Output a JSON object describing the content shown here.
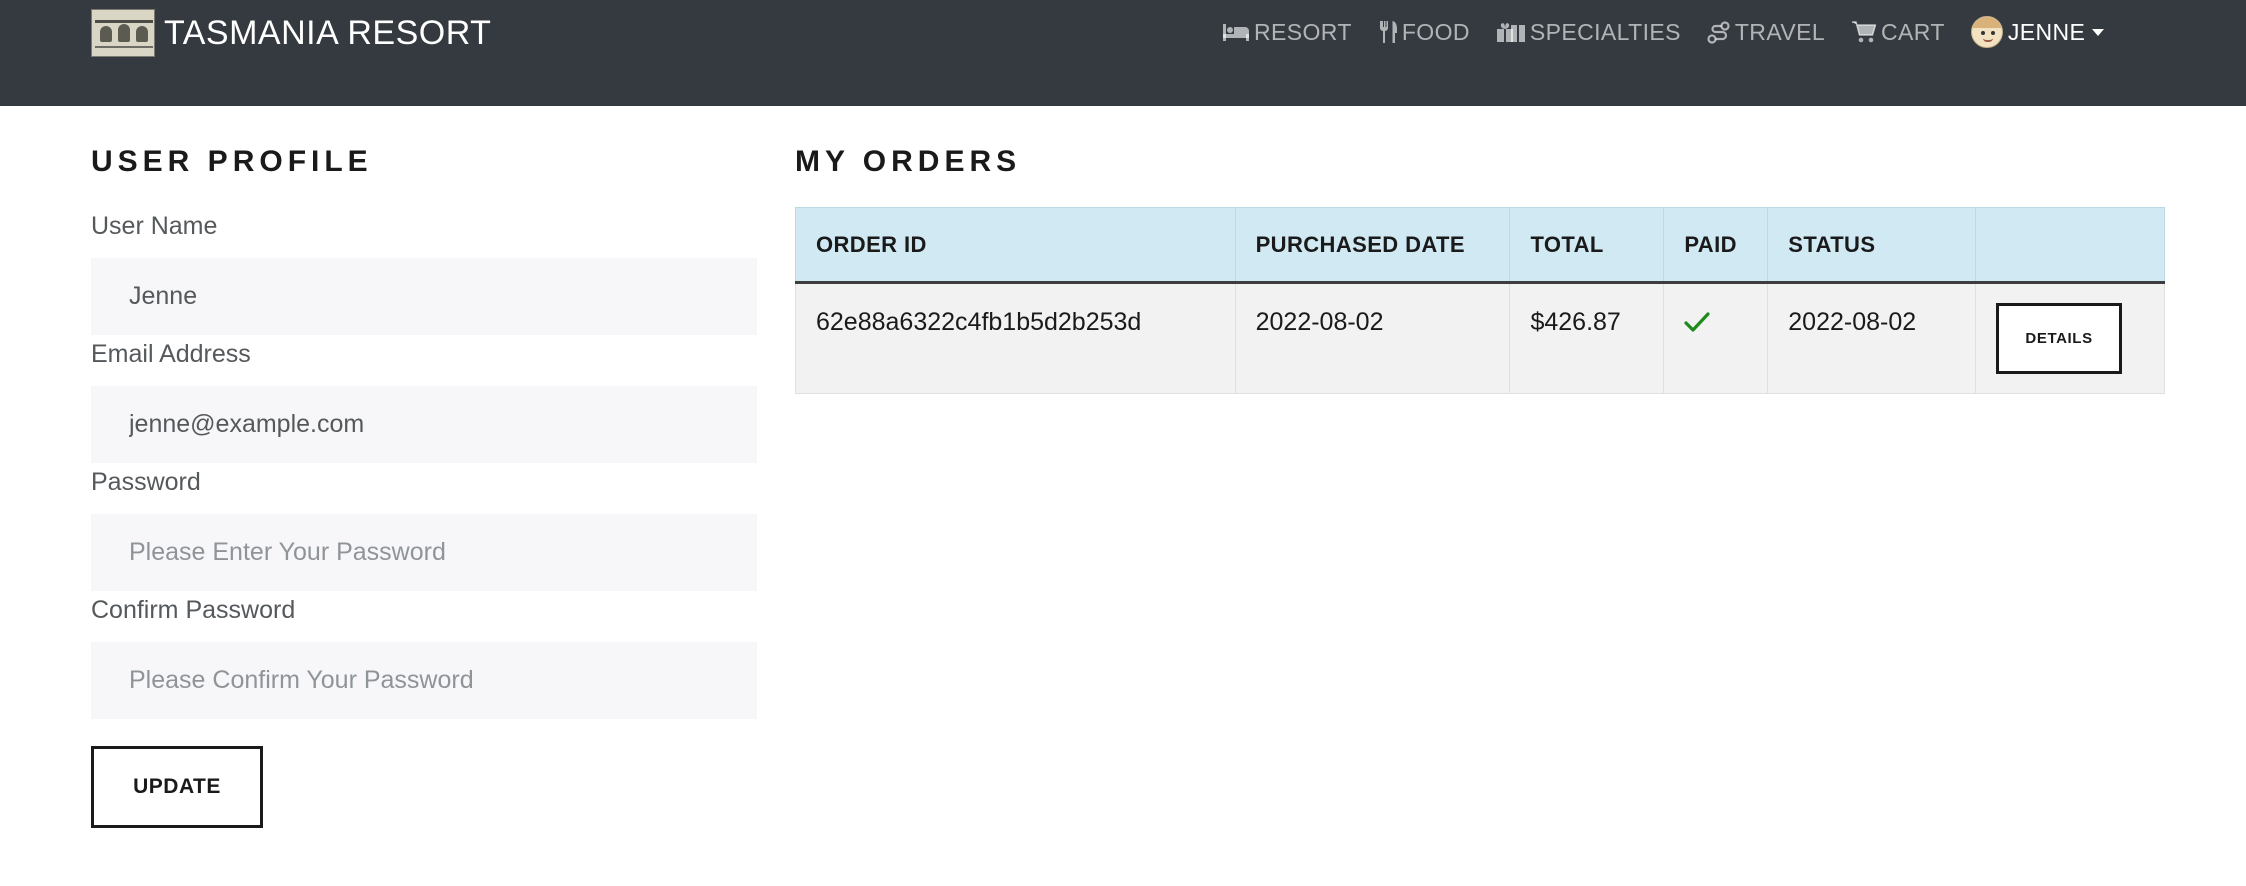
{
  "navbar": {
    "brand": "TASMANIA RESORT",
    "brand_logo_icon": "resort-logo-image",
    "items": [
      {
        "label": "RESORT",
        "icon": "bed-icon"
      },
      {
        "label": "FOOD",
        "icon": "utensils-icon"
      },
      {
        "label": "SPECIALTIES",
        "icon": "gifts-icon"
      },
      {
        "label": "TRAVEL",
        "icon": "route-icon"
      },
      {
        "label": "CART",
        "icon": "cart-icon"
      }
    ],
    "user": {
      "name": "JENNE",
      "icon": "user-avatar"
    },
    "background_color": "#343a40"
  },
  "profile": {
    "title": "USER PROFILE",
    "fields": [
      {
        "label": "User Name",
        "value": "Jenne",
        "placeholder": ""
      },
      {
        "label": "Email Address",
        "value": "jenne@example.com",
        "placeholder": ""
      },
      {
        "label": "Password",
        "value": "",
        "placeholder": "Please Enter Your Password"
      },
      {
        "label": "Confirm Password",
        "value": "",
        "placeholder": "Please Confirm Your Password"
      }
    ],
    "update_label": "UPDATE"
  },
  "orders": {
    "title": "MY ORDERS",
    "columns": [
      "ORDER ID",
      "PURCHASED DATE",
      "TOTAL",
      "PAID",
      "STATUS",
      ""
    ],
    "rows": [
      {
        "id": "62e88a6322c4fb1b5d2b253d",
        "date": "2022-08-02",
        "total": "$426.87",
        "paid": true,
        "status": "2022-08-02",
        "action_label": "DETAILS"
      }
    ],
    "header_color": "#d1e9f3",
    "paid_check_color": "#1e8a1e"
  }
}
